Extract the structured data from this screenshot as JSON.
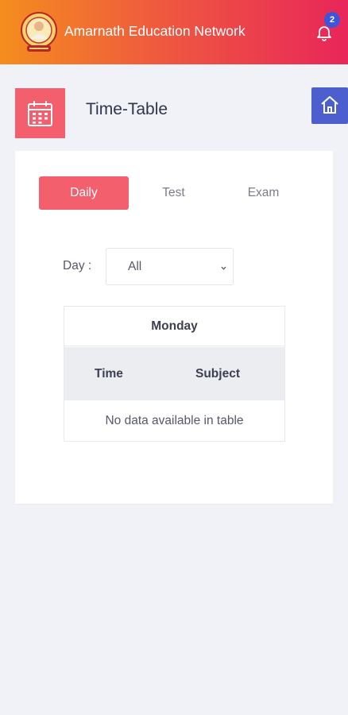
{
  "app": {
    "title": "Amarnath Education Network",
    "notification_count": "2"
  },
  "page": {
    "title": "Time-Table"
  },
  "tabs": [
    {
      "label": "Daily",
      "active": true
    },
    {
      "label": "Test",
      "active": false
    },
    {
      "label": "Exam",
      "active": false
    }
  ],
  "filter": {
    "label": "Day :",
    "selected": "All"
  },
  "table": {
    "day": "Monday",
    "columns": [
      "Time",
      "Subject"
    ],
    "empty_message": "No data available in table"
  },
  "colors": {
    "header_start": "#f48d1e",
    "header_end": "#e8265a",
    "accent": "#f45f6d",
    "home_button": "#4d5fcf",
    "badge": "#3d55d8"
  },
  "icons": {
    "logo": "school-emblem",
    "bell": "bell-icon",
    "calendar": "calendar-icon",
    "home": "home-icon",
    "chevron": "chevron-down-icon"
  }
}
